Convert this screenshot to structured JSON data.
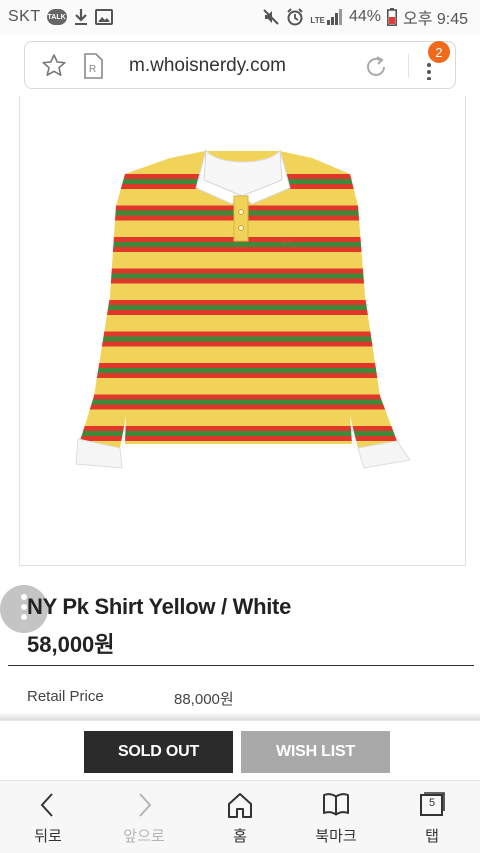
{
  "status_bar": {
    "carrier": "SKT",
    "talk_badge": "TALK",
    "network": "LTE",
    "battery": "44%",
    "time": "오후 9:45",
    "icons": [
      "talk-icon",
      "download-icon",
      "image-icon",
      "mute-icon",
      "alarm-icon",
      "signal-icon",
      "battery-icon"
    ]
  },
  "browser": {
    "url": "m.whoisnerdy.com",
    "tab_badge_count": "2",
    "icons": [
      "star-icon",
      "reader-icon",
      "reload-icon",
      "more-icon"
    ]
  },
  "product": {
    "image_alt": "Yellow striped polo shirt",
    "title": "NY Pk Shirt Yellow / White",
    "price": "58,000원",
    "retail_label": "Retail Price",
    "retail_value": "88,000원",
    "colors": {
      "body": "#f2d35a",
      "stripe_red": "#e0372b",
      "stripe_green": "#3f8a3a",
      "collar": "#f7f7f7"
    }
  },
  "actions": {
    "sold_out_label": "SOLD OUT",
    "wishlist_label": "WISH LIST",
    "sold_out_color": "#2b2b2b",
    "wishlist_color": "#a9a9a9"
  },
  "bottom_nav": {
    "items": [
      {
        "label": "뒤로",
        "icon": "back-icon"
      },
      {
        "label": "앞으로",
        "icon": "forward-icon"
      },
      {
        "label": "홈",
        "icon": "home-icon"
      },
      {
        "label": "북마크",
        "icon": "bookmark-icon"
      },
      {
        "label": "탭",
        "icon": "tabs-icon"
      }
    ],
    "tabs_count": "5"
  }
}
